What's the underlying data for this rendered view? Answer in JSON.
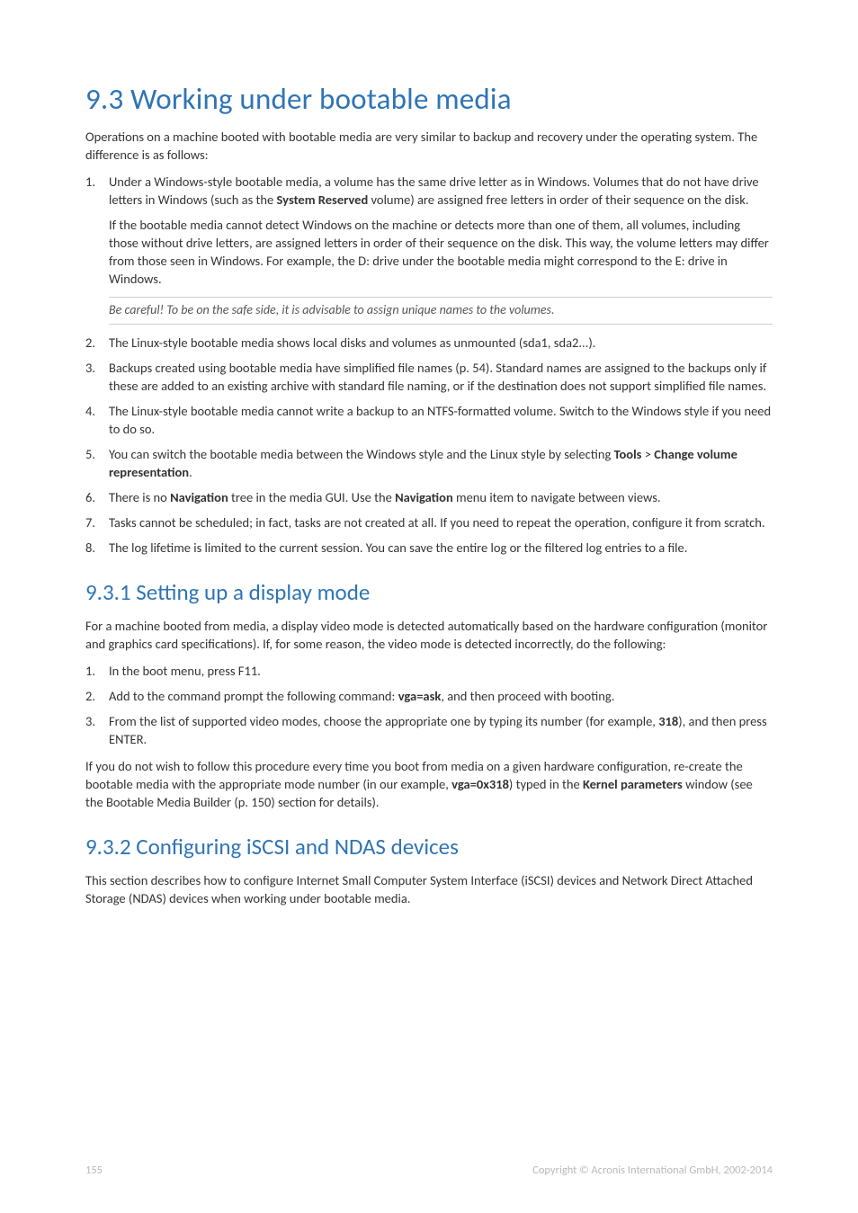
{
  "heading93": "9.3    Working under bootable media",
  "intro93": "Operations on a machine booted with bootable media are very similar to backup and recovery under the operating system. The difference is as follows:",
  "list93": {
    "i1_p1a": "Under a Windows-style bootable media, a volume has the same drive letter as in Windows. Volumes that do not have drive letters in Windows (such as the ",
    "i1_b1": "System Reserved",
    "i1_p1b": " volume) are assigned free letters in order of their sequence on the disk.",
    "i1_p2": "If the bootable media cannot detect Windows on the machine or detects more than one of them, all volumes, including those without drive letters, are assigned letters in order of their sequence on the disk. This way, the volume letters may differ from those seen in Windows. For example, the D: drive under the bootable media might correspond to the E: drive in Windows.",
    "note": "Be careful! To be on the safe side, it is advisable to assign unique names to the volumes.",
    "i2": "The Linux-style bootable media shows local disks and volumes as unmounted (sda1, sda2...).",
    "i3": "Backups created using bootable media have simplified file names (p. 54). Standard names are assigned to the backups only if these are added to an existing archive with standard file naming, or if the destination does not support simplified file names.",
    "i4": "The Linux-style bootable media cannot write a backup to an NTFS-formatted volume. Switch to the Windows style if you need to do so.",
    "i5a": "You can switch the bootable media between the Windows style and the Linux style by selecting ",
    "i5_b1": "Tools",
    "i5_sep": " > ",
    "i5_b2": "Change volume representation",
    "i5_end": ".",
    "i6a": "There is no ",
    "i6_b1": "Navigation",
    "i6b": " tree in the media GUI. Use the ",
    "i6_b2": "Navigation",
    "i6c": " menu item to navigate between views.",
    "i7": "Tasks cannot be scheduled; in fact, tasks are not created at all. If you need to repeat the operation, configure it from scratch.",
    "i8": "The log lifetime is limited to the current session. You can save the entire log or the filtered log entries to a file."
  },
  "heading931": "9.3.1     Setting up a display mode",
  "intro931": "For a machine booted from media, a display video mode is detected automatically based on the hardware configuration (monitor and graphics card specifications). If, for some reason, the video mode is detected incorrectly, do the following:",
  "list931": {
    "i1": "In the boot menu, press F11.",
    "i2a": "Add to the command prompt the following command: ",
    "i2_b": "vga=ask",
    "i2b": ", and then proceed with booting.",
    "i3a": "From the list of supported video modes, choose the appropriate one by typing its number (for example, ",
    "i3_b": "318",
    "i3b": "), and then press ENTER."
  },
  "para931a": "If you do not wish to follow this procedure every time you boot from media on a given hardware configuration, re-create the bootable media with the appropriate mode number (in our example, ",
  "para931_b1": "vga=0x318",
  "para931b": ") typed in the ",
  "para931_b2": "Kernel parameters",
  "para931c": " window (see the Bootable Media Builder (p. 150) section for details).",
  "heading932": "9.3.2     Configuring iSCSI and NDAS devices",
  "intro932": "This section describes how to configure Internet Small Computer System Interface (iSCSI) devices and Network Direct Attached Storage (NDAS) devices when working under bootable media.",
  "footer_page": "155",
  "footer_copy": "Copyright © Acronis International GmbH, 2002-2014"
}
